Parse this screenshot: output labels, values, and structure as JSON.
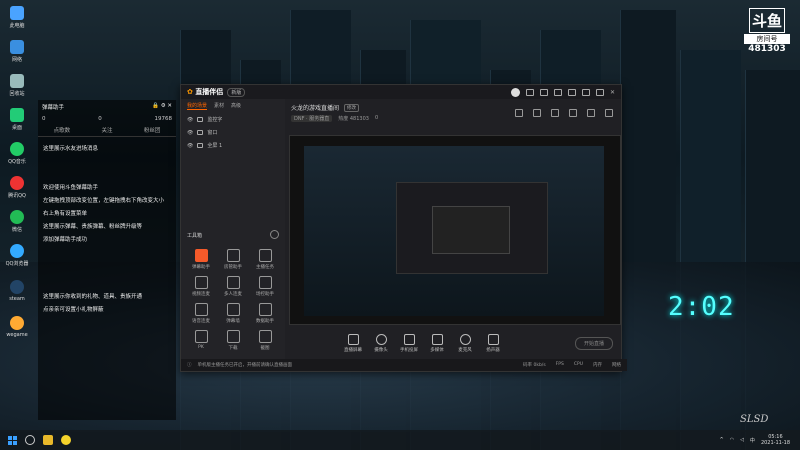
{
  "desktop": {
    "icons": [
      {
        "label": "此电脑",
        "color": "#4aa3ff"
      },
      {
        "label": "网络",
        "color": "#3a8fe0"
      },
      {
        "label": "回收站",
        "color": "#9bb"
      },
      {
        "label": "桌面",
        "color": "#2c7"
      },
      {
        "label": "QQ音乐",
        "color": "#2c6"
      },
      {
        "label": "腾讯QQ",
        "color": "#e33"
      },
      {
        "label": "微信",
        "color": "#2b5"
      },
      {
        "label": "QQ浏览器",
        "color": "#3af"
      },
      {
        "label": "steam",
        "color": "#246"
      },
      {
        "label": "wegame",
        "color": "#fa3"
      }
    ]
  },
  "logo": {
    "mark": "斗鱼",
    "room_label": "房间号",
    "room_number": "481303"
  },
  "danmu": {
    "title": "弹幕助手",
    "stats": [
      "0",
      "0",
      "19768"
    ],
    "tabs": [
      "点歌数",
      "关注",
      "粉丝团"
    ],
    "messages": [
      "这里展示水友进场消息",
      "欢迎使用斗鱼弹幕助手",
      "左键拖拽顶部改变位置，左键拖拽右下角改变大小",
      "右上角有设置菜单",
      "这里展示弹幕、贵族弹幕、粉丝牌升级等",
      "添加弹幕助手成功",
      "这里展示你收到的礼物、道具、贵族开通",
      "点亲亲可设置小礼物屏蔽"
    ]
  },
  "app": {
    "brand": "直播伴侣",
    "brand_tag": "新版",
    "left_tabs": [
      "我的场景",
      "素材",
      "高级"
    ],
    "scenes": [
      "监控字",
      "窗口",
      "全屏 1"
    ],
    "tools_title": "工具箱",
    "tools": [
      {
        "label": "弹幕助手",
        "hot": true
      },
      {
        "label": "房管助手",
        "hot": false
      },
      {
        "label": "主播任务",
        "hot": false
      },
      {
        "label": "视频连麦",
        "hot": false
      },
      {
        "label": "多人连麦",
        "hot": false
      },
      {
        "label": "场控助手",
        "hot": false
      },
      {
        "label": "语音连麦",
        "hot": false
      },
      {
        "label": "弹幕墙",
        "hot": false
      },
      {
        "label": "数据助手",
        "hot": false
      },
      {
        "label": "PK",
        "hot": false
      },
      {
        "label": "下载",
        "hot": false
      },
      {
        "label": "截图",
        "hot": false
      }
    ],
    "room_title": "火龙的游戏直播间",
    "room_tag": "修改",
    "room_category": "DNF · 服务器直",
    "room_heat": "热度 481303",
    "room_fans": "0",
    "bottom_buttons": [
      "直播屏幕",
      "摄像头",
      "手机投屏",
      "多媒体",
      "麦克风",
      "扬声器"
    ],
    "start_button": "开始直播",
    "status_text": "单机版主播任务已开启，开播前请确认直播画面",
    "status_right": [
      "码率 0kb/s",
      "FPS",
      "CPU",
      "内存",
      "网络"
    ]
  },
  "taskbar": {
    "time": "05:16",
    "date": "2021-11-18",
    "lang": "中"
  },
  "clock_overlay": "2:02",
  "signature": "SLSD"
}
